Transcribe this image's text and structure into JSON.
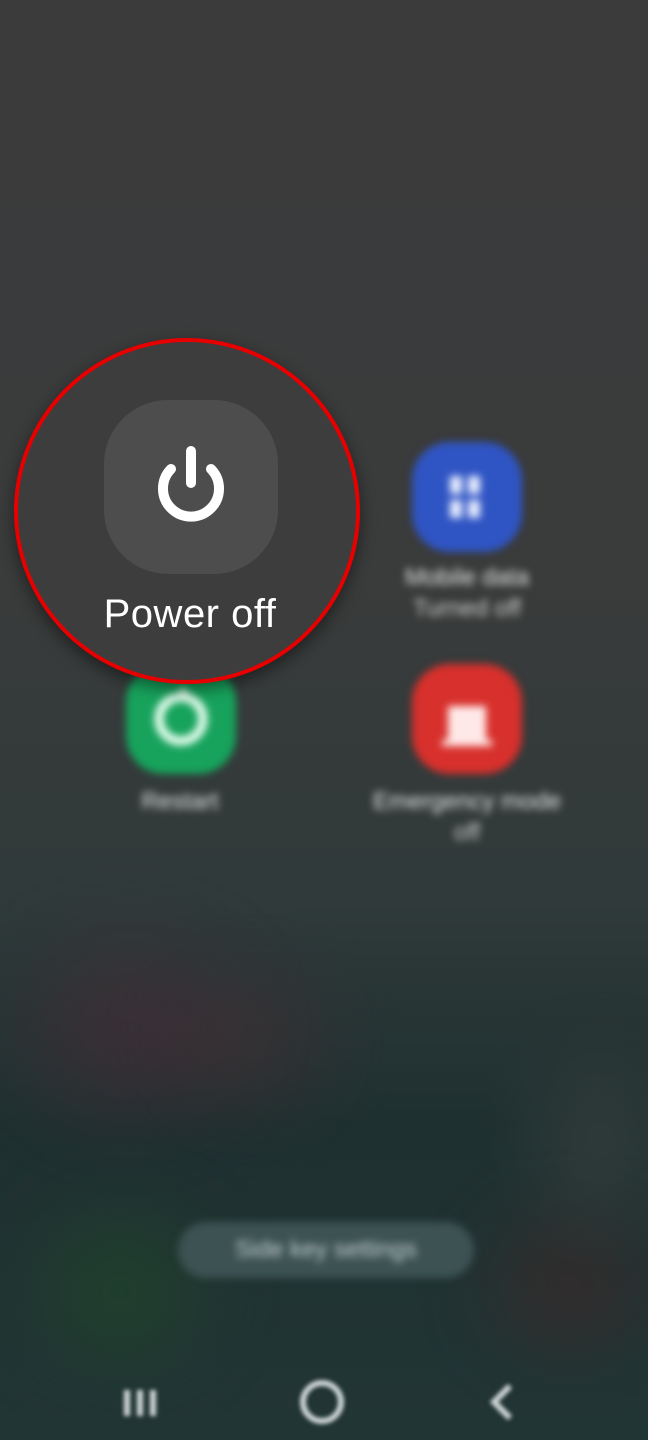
{
  "power_menu": {
    "power_off": {
      "label": "Power off",
      "icon": "power-icon"
    },
    "mobile_data": {
      "label": "Mobile data",
      "sublabel": "Turned off",
      "icon": "mobile-data-icon",
      "color": "#2f55c4"
    },
    "restart": {
      "label": "Restart",
      "icon": "restart-icon",
      "color": "#17a35c"
    },
    "emergency_mode": {
      "label": "Emergency mode",
      "sublabel": "off",
      "icon": "emergency-icon",
      "color": "#d8302c"
    },
    "side_key_settings": {
      "label": "Side key settings"
    }
  },
  "nav_bar": {
    "recents": {
      "icon": "recents-icon"
    },
    "home": {
      "icon": "home-icon"
    },
    "back": {
      "icon": "back-icon"
    }
  },
  "colors": {
    "highlight_ring": "#e60000",
    "power_tile": "#4d4d4d"
  }
}
